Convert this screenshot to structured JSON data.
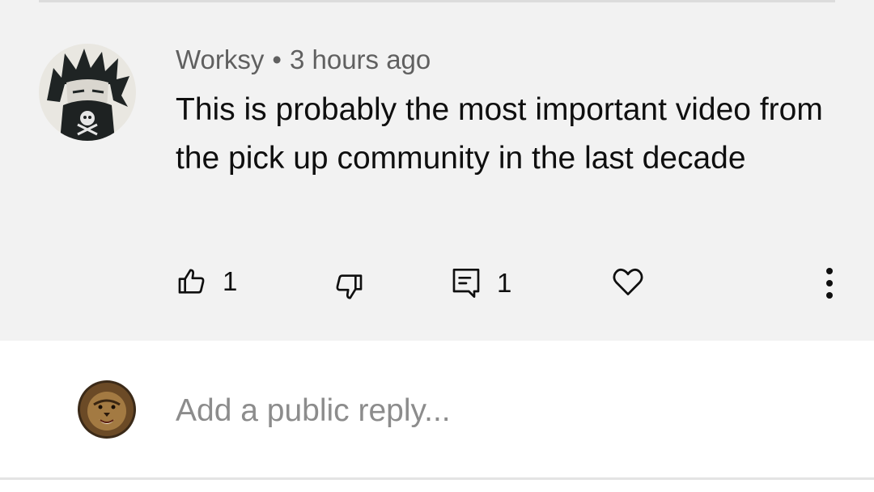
{
  "comment": {
    "author": "Worksy",
    "separator": "•",
    "time": "3 hours ago",
    "text": "This is probably the most important video from the pick up community in the last decade",
    "like_count": "1",
    "reply_count": "1"
  },
  "reply_box": {
    "placeholder": "Add a public reply..."
  },
  "icons": {
    "like": "thumbs-up-icon",
    "dislike": "thumbs-down-icon",
    "reply": "comment-reply-icon",
    "heart": "heart-icon",
    "more": "more-vertical-icon"
  },
  "colors": {
    "card_background": "#f2f2f2",
    "page_background": "#ffffff",
    "meta_text": "#606060",
    "body_text": "#0f0f0f",
    "placeholder_text": "#8c8c8c"
  }
}
